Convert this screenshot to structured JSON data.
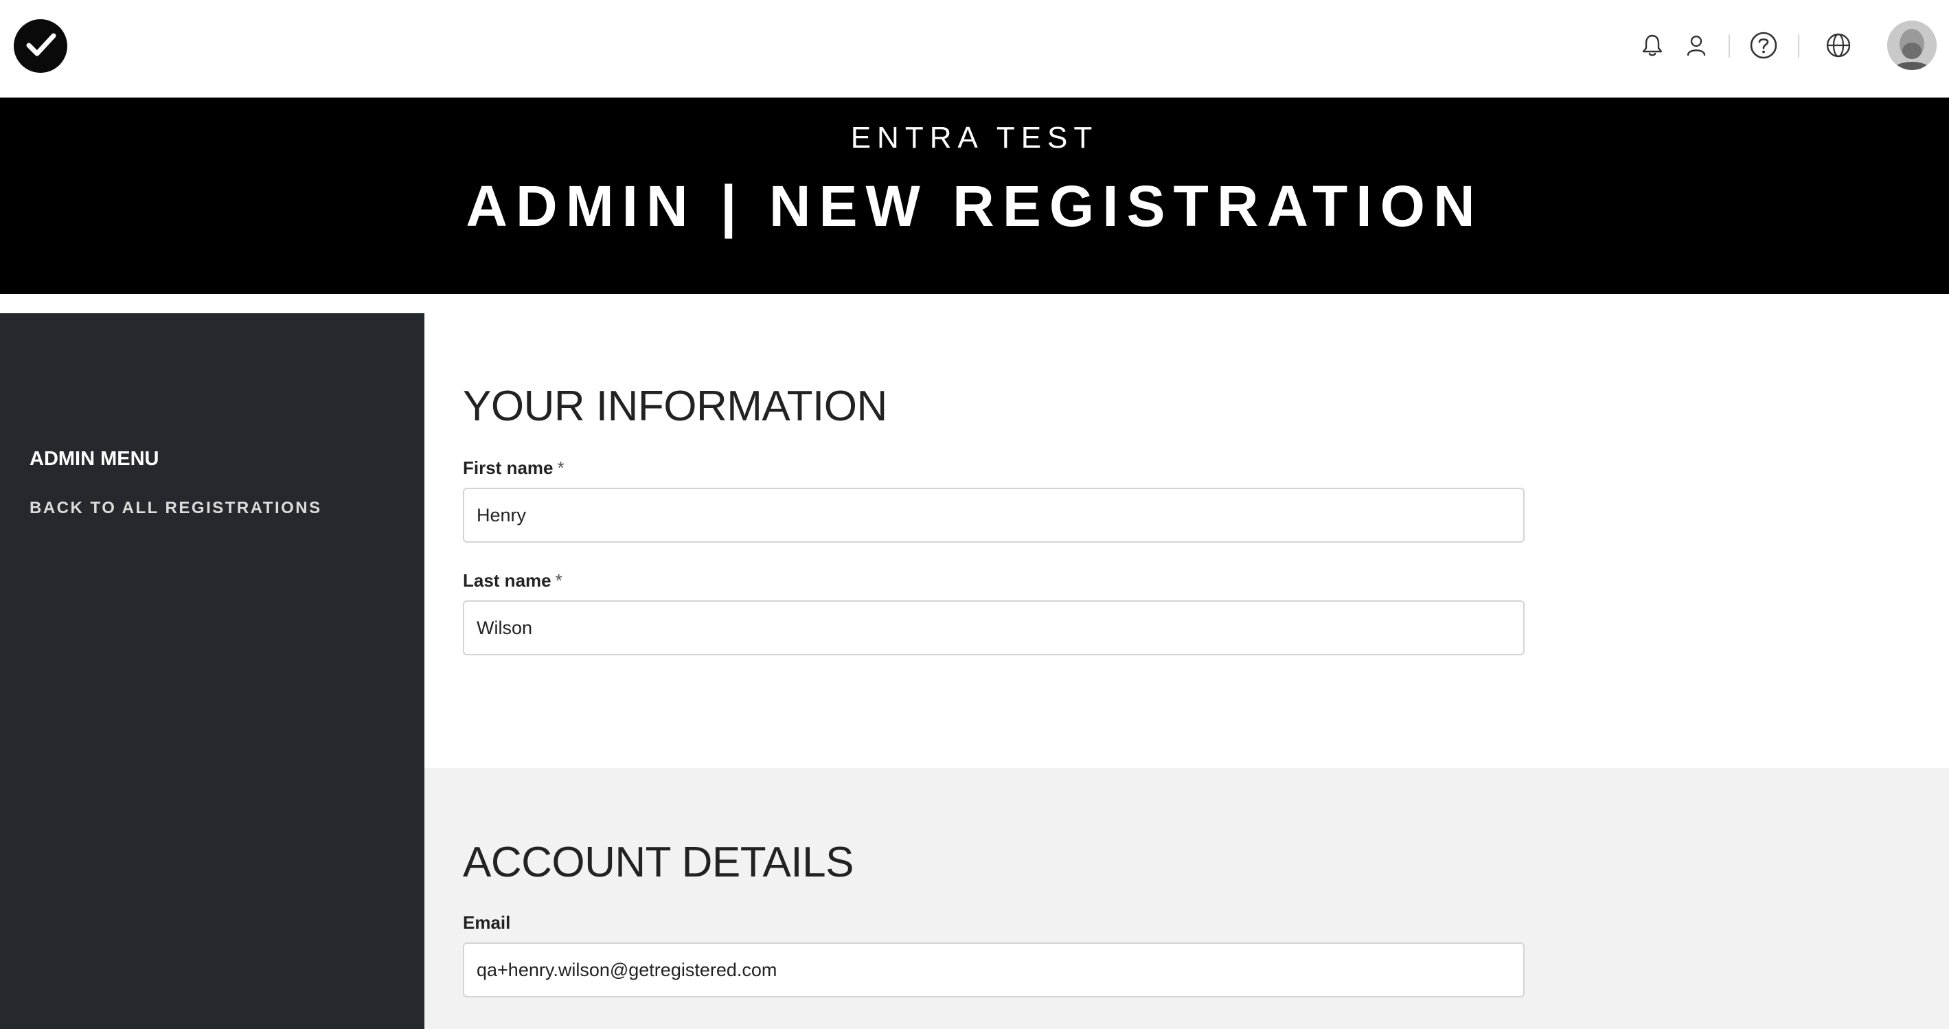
{
  "topbar": {
    "logo": "checkmark-logo",
    "icons": [
      "bell-icon",
      "user-icon",
      "help-icon",
      "globe-icon"
    ],
    "avatar": "user-avatar"
  },
  "hero": {
    "subtitle": "ENTRA TEST",
    "title": "ADMIN | NEW REGISTRATION"
  },
  "sidebar": {
    "heading": "ADMIN MENU",
    "link": "BACK TO ALL REGISTRATIONS"
  },
  "your_information": {
    "title": "YOUR INFORMATION",
    "first_name": {
      "label": "First name",
      "required": "*",
      "value": "Henry"
    },
    "last_name": {
      "label": "Last name",
      "required": "*",
      "value": "Wilson"
    }
  },
  "account_details": {
    "title": "ACCOUNT DETAILS",
    "email": {
      "label": "Email",
      "value": "qa+henry.wilson@getregistered.com"
    }
  },
  "colors": {
    "hero_bg": "#000000",
    "sidebar_bg": "#25282d",
    "account_bg": "#f2f2f2"
  }
}
